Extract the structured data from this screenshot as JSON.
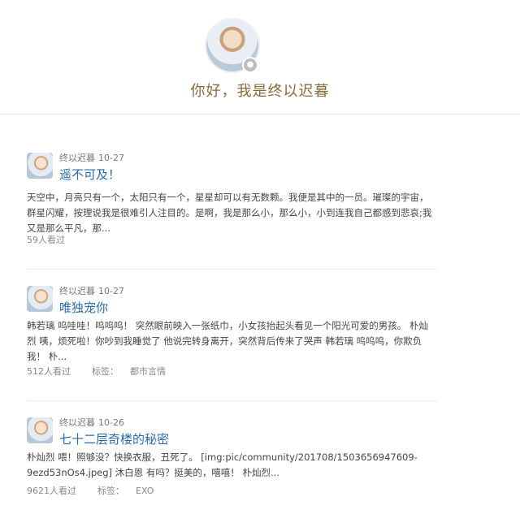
{
  "profile": {
    "greeting": "你好，我是终以迟暮",
    "avatar_badge_icon": "camera-icon"
  },
  "posts": [
    {
      "author": "终以迟暮",
      "date": "10-27",
      "title": "遥不可及！",
      "body": "天空中，月亮只有一个，太阳只有一个，星星却可以有无数颗。我便是其中的一员。璀璨的宇宙，群星闪耀，按理说我是很难引人注目的。是啊，我是那么小，那么小，小到连我自己都感到悲哀;我又是那么平凡，那...",
      "views": "59人看过",
      "tag_label": "",
      "tag_value": ""
    },
    {
      "author": "终以迟暮",
      "date": "10-27",
      "title": "唯独宠你",
      "body": "韩若璃 呜哇哇！呜呜呜！ 突然眼前映入一张纸巾，小女孩抬起头看见一个阳光可爱的男孩。 朴灿烈 咦，烦死啦！你吵到我睡觉了 他说完转身离开，突然背后传来了哭声 韩若璃 呜呜呜，你欺负我！ 朴...",
      "views": "512人看过",
      "tag_label": "标签：",
      "tag_value": "都市言情"
    },
    {
      "author": "终以迟暮",
      "date": "10-26",
      "title": "七十二层奇楼的秘密",
      "body": "朴灿烈 喂！照够没？快换衣服，丑死了。 [img:pic/community/201708/1503656947609-9ezd53nOs4.jpeg] 沐白恩 有吗？挺美的，嘻嘻！ 朴灿烈...",
      "views": "9621人看过",
      "tag_label": "标签：",
      "tag_value": "EXO"
    }
  ]
}
